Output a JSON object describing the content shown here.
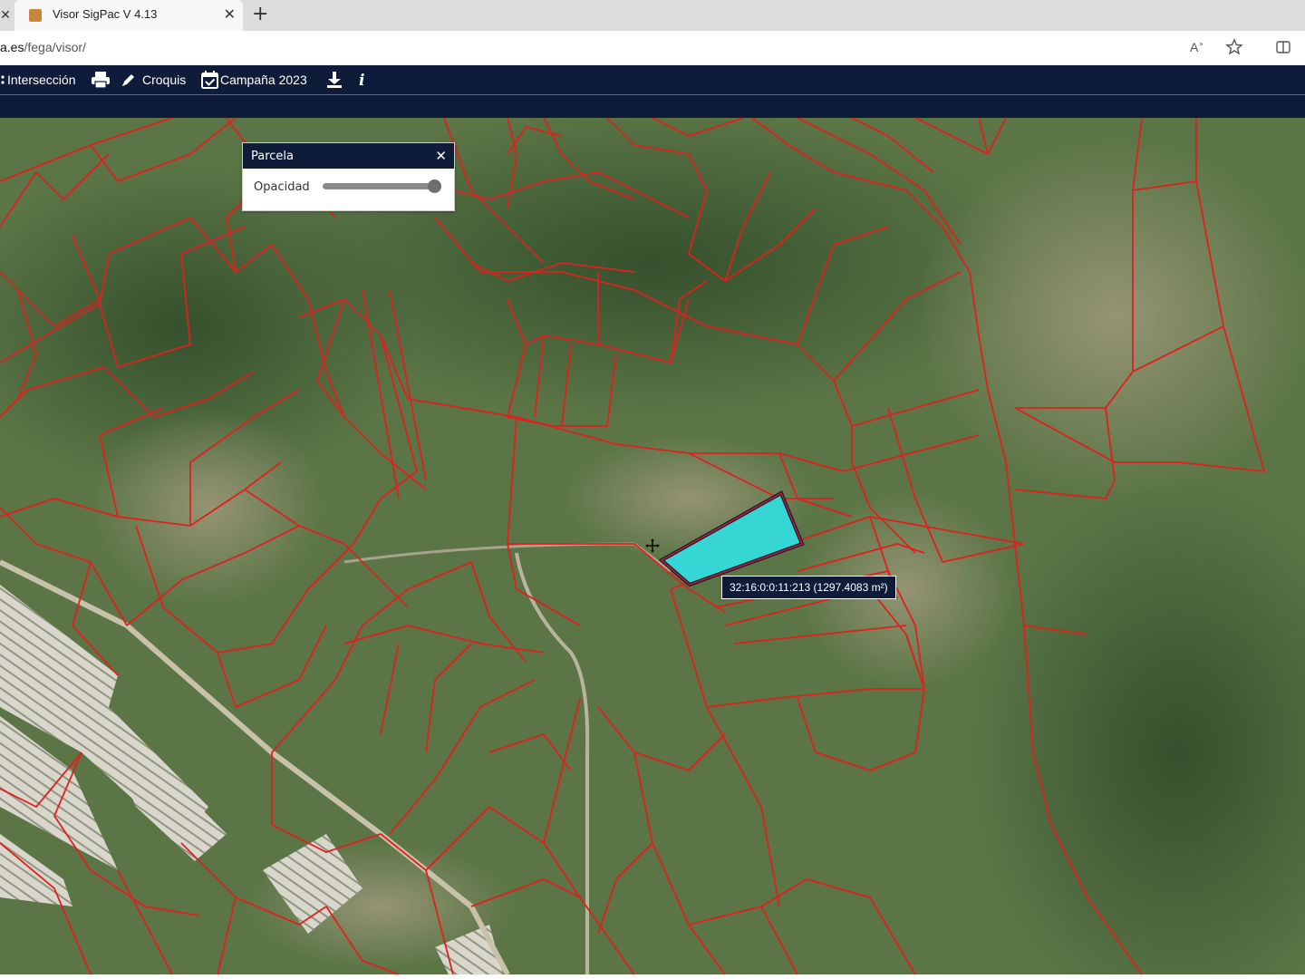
{
  "browser": {
    "tab_title": "Visor SigPac V 4.13",
    "url_domain": "a.es",
    "url_path": "/fega/visor/"
  },
  "toolbar": {
    "intersection_label": "Intersección",
    "sketch_label": "Croquis",
    "campaign_label": "Campaña 2023"
  },
  "layer_panel": {
    "title": "Parcela",
    "opacity_label": "Opacidad",
    "opacity_value": 0.95
  },
  "map": {
    "selected_parcel_label": "32:16:0:0:11:213 (1297.4083 m²)",
    "colors": {
      "parcel_border": "#e0201e",
      "selected_fill": "#36d6d4",
      "vegetation_dark": "#3d5a33",
      "vegetation_light": "#6f8a55",
      "bare_ground": "#9a9578"
    }
  },
  "icons": {
    "print": "print-icon",
    "sketch": "pencil-icon",
    "campaign": "calendar-check-icon",
    "download": "download-icon",
    "info": "info-icon",
    "read_aloud": "read-aloud-icon",
    "favorite": "star-icon",
    "split": "split-screen-icon"
  }
}
